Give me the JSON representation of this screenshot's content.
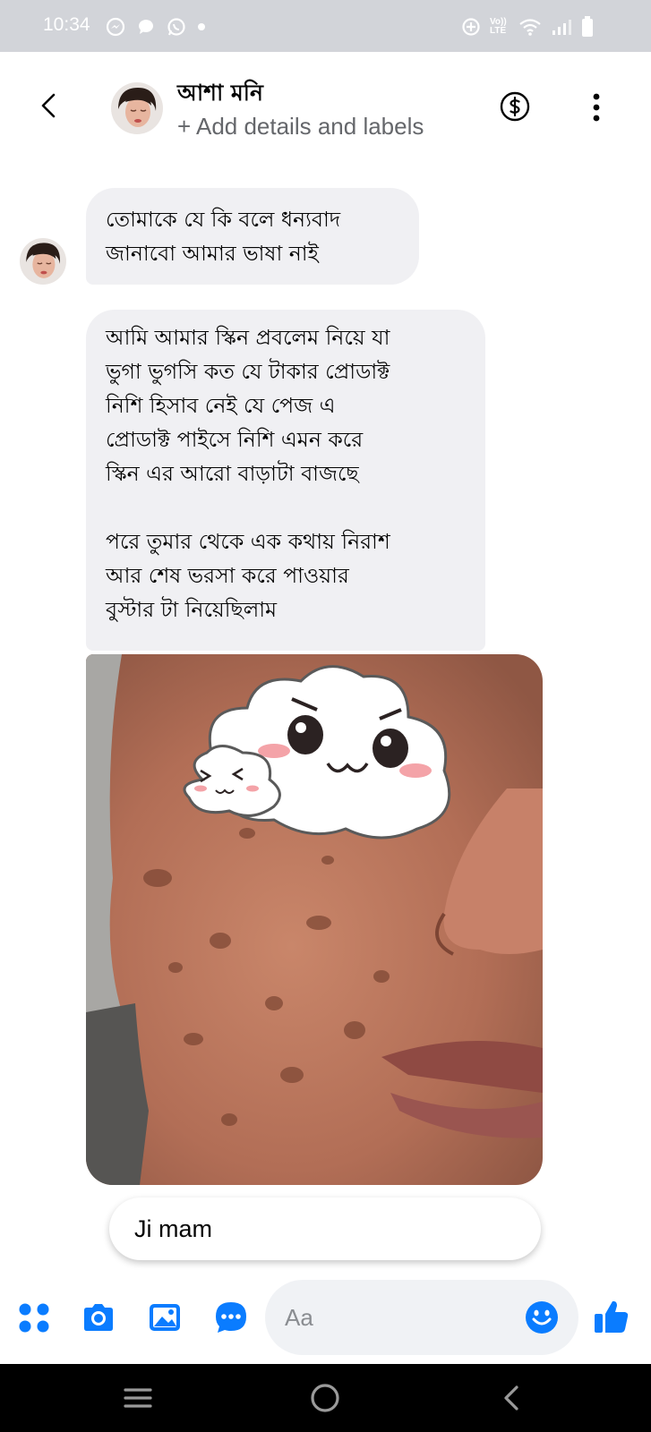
{
  "status_bar": {
    "time": "10:34",
    "left_icons": [
      "messenger-icon",
      "chat-bubble-icon",
      "whatsapp-icon",
      "dot-icon"
    ],
    "right_icons": [
      "data-saver-icon",
      "volte-icon",
      "wifi-icon",
      "signal-icon",
      "battery-icon"
    ],
    "volte_label": "Vo)) LTE"
  },
  "header": {
    "contact_name": "আশা মনি",
    "subtitle": "+ Add details and labels",
    "icons": [
      "back-icon",
      "dollar-icon",
      "more-icon"
    ]
  },
  "messages": [
    {
      "direction": "incoming",
      "type": "text",
      "text": "তোমাকে যে কি বলে ধন্যবাদ\nজানাবো আমার ভাষা নাই"
    },
    {
      "direction": "incoming",
      "type": "text",
      "text": "আমি আমার স্কিন প্রবলেম নিয়ে যা\nভুগা ভুগসি কত যে টাকার প্রোডাক্ট\nনিশি হিসাব নেই যে পেজ এ\nপ্রোডাক্ট পাইসে নিশি এমন করে\nস্কিন এর আরো বাড়াটা বাজছে\n\nপরে তুমার থেকে এক কথায় নিরাশ\nআর শেষ ভরসা করে পাওয়ার\nবুস্টার টা নিয়েছিলাম"
    },
    {
      "direction": "incoming",
      "type": "photo",
      "content": "photo"
    }
  ],
  "quick_reply": {
    "text": "Ji mam"
  },
  "composer": {
    "placeholder": "Aa",
    "icons": [
      "apps-icon",
      "camera-icon",
      "gallery-icon",
      "chat-icon",
      "emoji-icon",
      "like-icon"
    ]
  },
  "colors": {
    "accent": "#0a7cff",
    "bubble": "#f0f0f3",
    "status_bar": "#d2d4d9",
    "secondary_text": "#65676b"
  }
}
